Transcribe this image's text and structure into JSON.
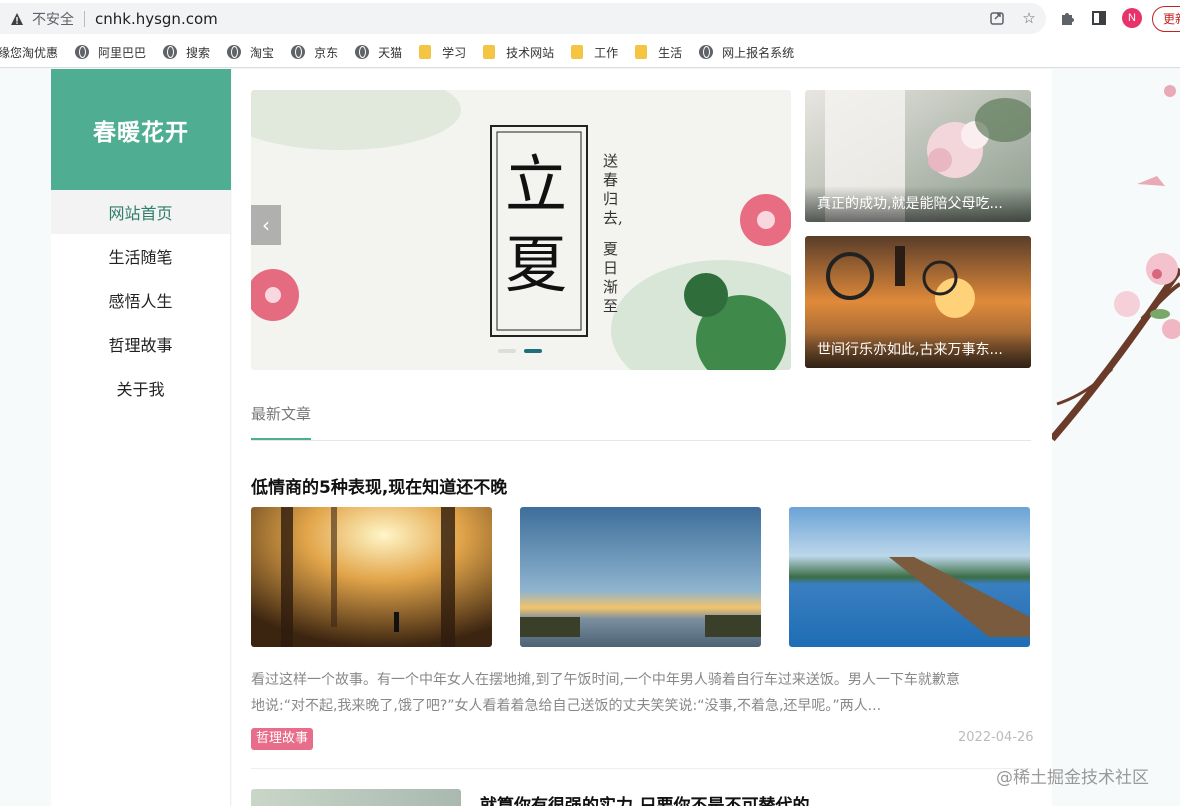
{
  "browser": {
    "security_label": "不安全",
    "url": "cnhk.hysgn.com",
    "profile_initial": "N",
    "update_label": "更新"
  },
  "bookmarks": [
    {
      "label": "缘您淘优惠",
      "icon": "none"
    },
    {
      "label": "阿里巴巴",
      "icon": "globe-icon"
    },
    {
      "label": "搜索",
      "icon": "globe-icon"
    },
    {
      "label": "淘宝",
      "icon": "globe-icon"
    },
    {
      "label": "京东",
      "icon": "globe-icon"
    },
    {
      "label": "天猫",
      "icon": "globe-icon"
    },
    {
      "label": "学习",
      "icon": "folder-icon"
    },
    {
      "label": "技术网站",
      "icon": "folder-icon"
    },
    {
      "label": "工作",
      "icon": "folder-icon"
    },
    {
      "label": "生活",
      "icon": "folder-icon"
    },
    {
      "label": "网上报名系统",
      "icon": "globe-icon"
    }
  ],
  "site": {
    "logo": "春暖花开",
    "nav": [
      "网站首页",
      "生活随笔",
      "感悟人生",
      "哲理故事",
      "关于我"
    ],
    "active_nav": "网站首页"
  },
  "banner": {
    "big_char_1": "立",
    "big_char_2": "夏",
    "poem_col_1": "送春归去,",
    "poem_col_2": "夏日渐至"
  },
  "features": [
    {
      "caption": "真正的成功,就是能陪父母吃..."
    },
    {
      "caption": "世间行乐亦如此,古来万事东..."
    }
  ],
  "section": {
    "title": "最新文章"
  },
  "article": {
    "title": "低情商的5种表现,现在知道还不晚",
    "excerpt_line_1": "看过这样一个故事。有一个中年女人在摆地摊,到了午饭时间,一个中年男人骑着自行车过来送饭。男人一下车就歉意",
    "excerpt_line_2": "地说:“对不起,我来晚了,饿了吧?”女人看着着急给自己送饭的丈夫笑笑说:“没事,不着急,还早呢。”两人...",
    "tag": "哲理故事",
    "date": "2022-04-26"
  },
  "article2": {
    "title": "就算你有很强的实力,只要你不是不可替代的"
  },
  "watermark": "@稀土掘金技术社区",
  "colors": {
    "accent": "#4fae92",
    "tag": "#e86d8b",
    "active_nav": "#2f7d6b"
  }
}
